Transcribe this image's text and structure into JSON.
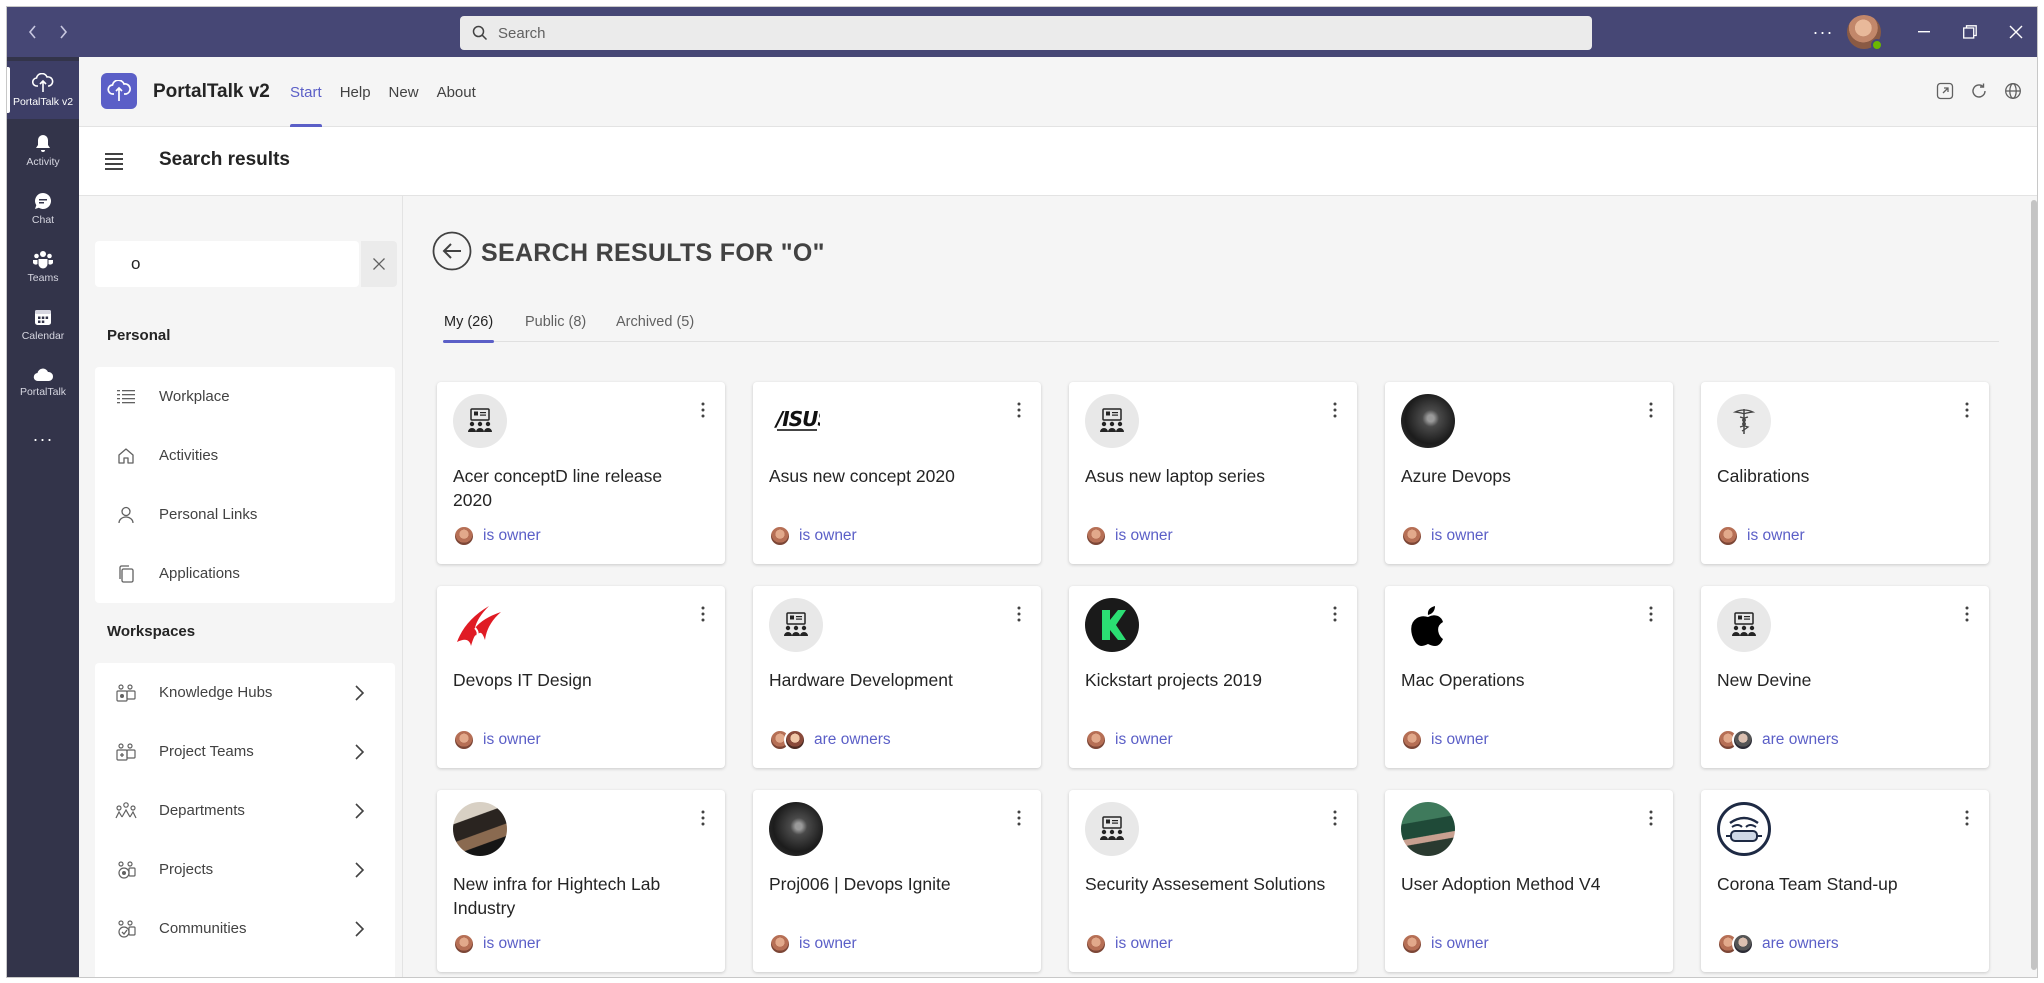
{
  "titlebar": {
    "search_placeholder": "Search",
    "more_label": "···"
  },
  "rail": {
    "items": [
      {
        "label": "PortalTalk v2",
        "icon": "portaltalk-icon"
      },
      {
        "label": "Activity",
        "icon": "bell-icon"
      },
      {
        "label": "Chat",
        "icon": "chat-icon"
      },
      {
        "label": "Teams",
        "icon": "teams-icon"
      },
      {
        "label": "Calendar",
        "icon": "calendar-icon"
      },
      {
        "label": "PortalTalk",
        "icon": "cloud-icon"
      }
    ],
    "more_label": "···"
  },
  "app": {
    "name": "PortalTalk v2",
    "tabs": [
      "Start",
      "Help",
      "New",
      "About"
    ],
    "active_tab": "Start"
  },
  "page": {
    "title": "Search results"
  },
  "left": {
    "search_value": "o",
    "personal_heading": "Personal",
    "personal_items": [
      {
        "label": "Workplace",
        "icon": "list-icon"
      },
      {
        "label": "Activities",
        "icon": "home-icon"
      },
      {
        "label": "Personal Links",
        "icon": "person-icon"
      },
      {
        "label": "Applications",
        "icon": "copy-icon"
      }
    ],
    "workspaces_heading": "Workspaces",
    "workspace_items": [
      {
        "label": "Knowledge Hubs",
        "icon": "knowledge-hub-icon"
      },
      {
        "label": "Project Teams",
        "icon": "project-teams-icon"
      },
      {
        "label": "Departments",
        "icon": "departments-icon"
      },
      {
        "label": "Projects",
        "icon": "projects-icon"
      },
      {
        "label": "Communities",
        "icon": "communities-icon"
      }
    ]
  },
  "results": {
    "title": "SEARCH RESULTS FOR \"O\"",
    "tabs": [
      {
        "label": "My (26)",
        "active": true
      },
      {
        "label": "Public (8)",
        "active": false
      },
      {
        "label": "Archived (5)",
        "active": false
      }
    ],
    "cards": [
      {
        "title": "Acer conceptD line release 2020",
        "owner": "is owner",
        "logo": "default-workspace-icon"
      },
      {
        "title": "Asus new concept 2020",
        "owner": "is owner",
        "logo": "asus-logo"
      },
      {
        "title": "Asus new laptop series",
        "owner": "is owner",
        "logo": "default-workspace-icon"
      },
      {
        "title": "Azure Devops",
        "owner": "is owner",
        "logo": "dark-orb-photo"
      },
      {
        "title": "Calibrations",
        "owner": "is owner",
        "logo": "caduceus-icon"
      },
      {
        "title": "Devops IT Design",
        "owner": "is owner",
        "logo": "rog-logo"
      },
      {
        "title": "Hardware Development",
        "owner": "are owners",
        "logo": "default-workspace-icon"
      },
      {
        "title": "Kickstart projects 2019",
        "owner": "is owner",
        "logo": "kickstarter-logo"
      },
      {
        "title": "Mac Operations",
        "owner": "is owner",
        "logo": "apple-logo"
      },
      {
        "title": "New Devine",
        "owner": "are owners",
        "logo": "default-workspace-icon"
      },
      {
        "title": "New infra for Hightech Lab Industry",
        "owner": "is owner",
        "logo": "lab-photo"
      },
      {
        "title": "Proj006 | Devops Ignite",
        "owner": "is owner",
        "logo": "dark-orb-photo"
      },
      {
        "title": "Security Assesement Solutions",
        "owner": "is owner",
        "logo": "default-workspace-icon"
      },
      {
        "title": "User Adoption Method V4",
        "owner": "is owner",
        "logo": "team-photo"
      },
      {
        "title": "Corona Team Stand-up",
        "owner": "are owners",
        "logo": "corona-mascot"
      }
    ]
  },
  "colors": {
    "titlebar": "#464775",
    "rail": "#33344a",
    "accent": "#5b5fc7"
  }
}
